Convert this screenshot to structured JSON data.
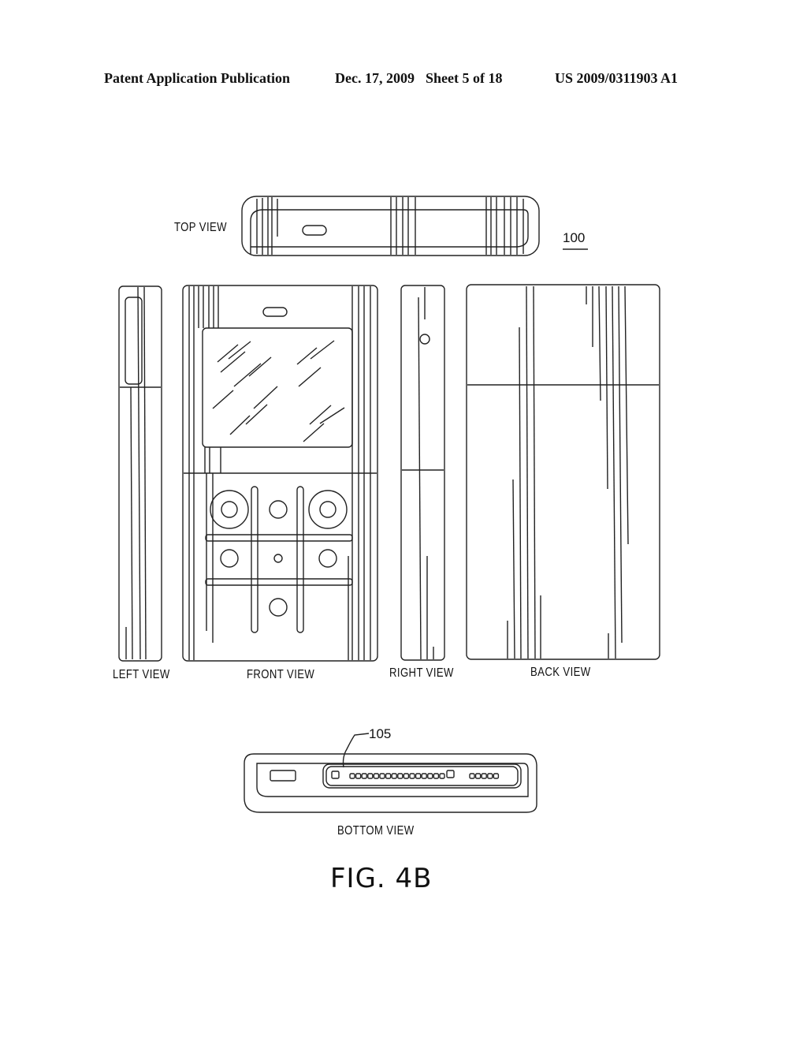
{
  "header": {
    "publication": "Patent Application Publication",
    "date": "Dec. 17, 2009",
    "sheet": "Sheet 5 of 18",
    "number": "US 2009/0311903 A1"
  },
  "figure": {
    "label": "FIG. 4B",
    "reference_numerals": {
      "device": "100",
      "connector": "105"
    },
    "views": {
      "top": "TOP VIEW",
      "left": "LEFT VIEW",
      "front": "FRONT VIEW",
      "right": "RIGHT VIEW",
      "back": "BACK VIEW",
      "bottom": "BOTTOM VIEW"
    }
  }
}
